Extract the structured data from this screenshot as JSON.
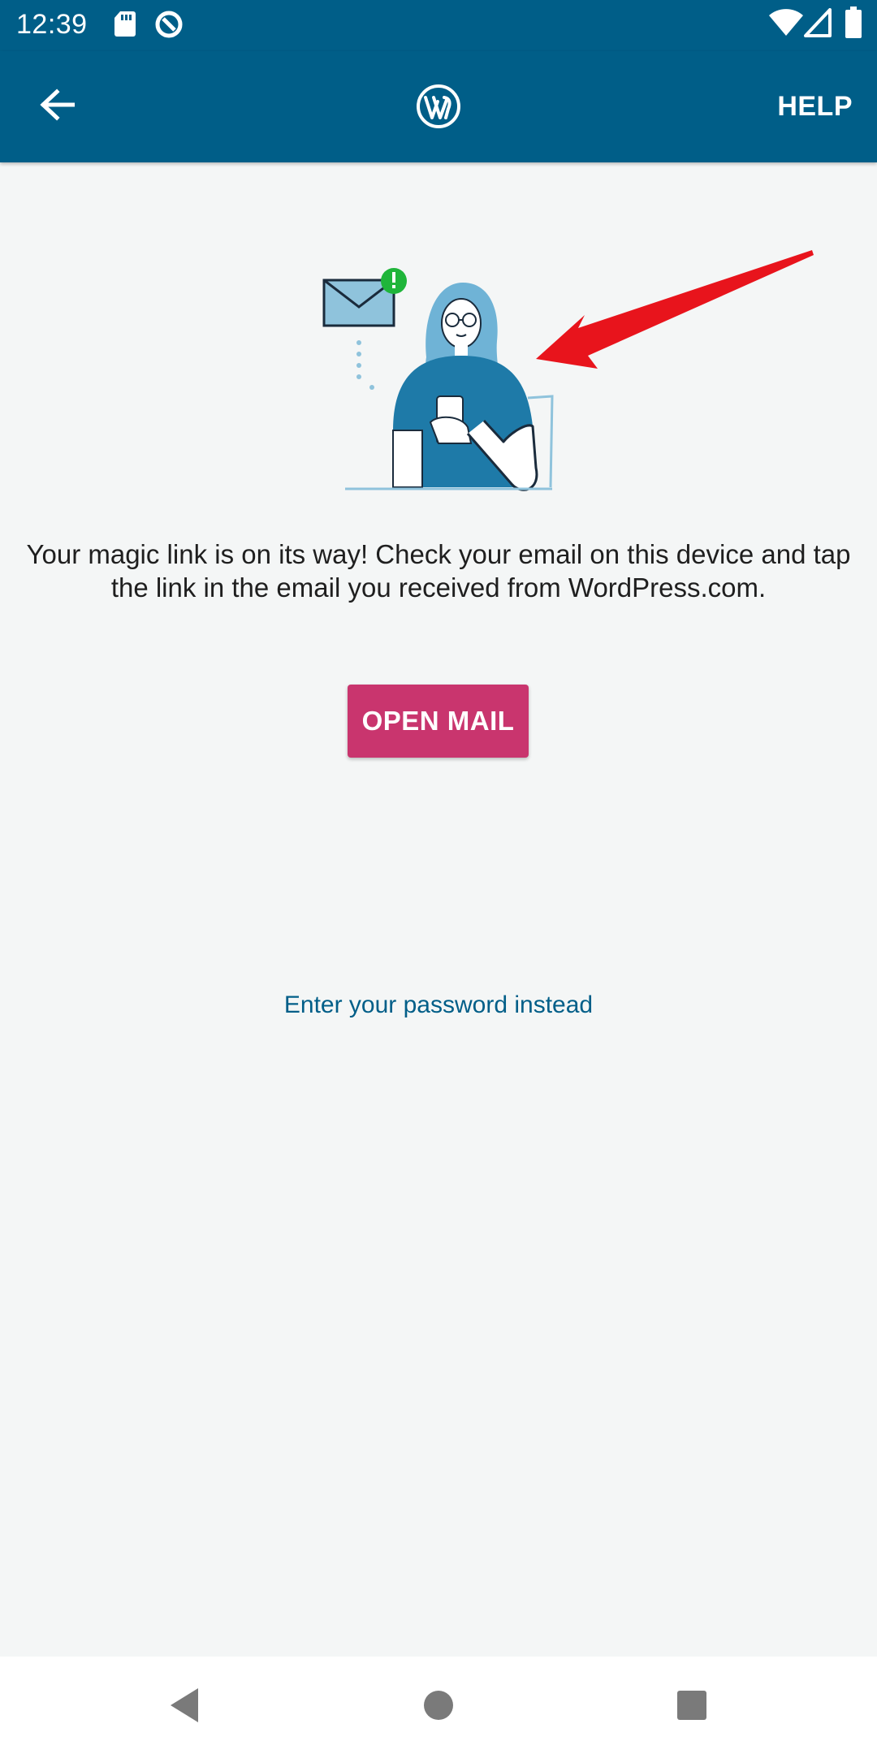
{
  "status_bar": {
    "time": "12:39",
    "left_icons": [
      "sd-card-icon",
      "data-saver-icon"
    ],
    "right_icons": [
      "wifi-icon",
      "cell-signal-icon",
      "battery-icon"
    ]
  },
  "app_bar": {
    "back_icon": "arrow-left-icon",
    "logo_icon": "wordpress-logo-icon",
    "help_label": "HELP"
  },
  "main": {
    "illustration": "woman-with-phone-and-email-illustration",
    "message": "Your magic link is on its way! Check your email on this device and tap the link in the email you received from WordPress.com.",
    "open_mail_label": "OPEN MAIL",
    "password_link_label": "Enter your password instead"
  },
  "nav_bar": {
    "icons": [
      "back-triangle-icon",
      "home-circle-icon",
      "recents-square-icon"
    ]
  },
  "colors": {
    "primary": "#005e88",
    "accent": "#c9356e",
    "background": "#f4f6f6",
    "annotation_arrow": "#e8141c",
    "badge_green": "#1fb53a"
  }
}
